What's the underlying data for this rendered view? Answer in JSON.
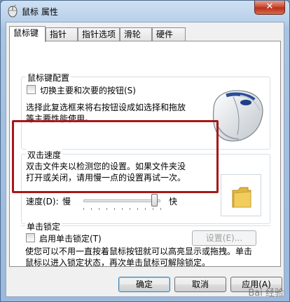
{
  "window": {
    "title": "鼠标 属性",
    "close_glyph": "✕"
  },
  "tabs": [
    {
      "label": "鼠标键",
      "active": true
    },
    {
      "label": "指针",
      "active": false
    },
    {
      "label": "指针选项",
      "active": false
    },
    {
      "label": "滑轮",
      "active": false
    },
    {
      "label": "硬件",
      "active": false
    }
  ],
  "button_config": {
    "group_label": "鼠标键配置",
    "switch_checkbox_label": "切换主要和次要的按钮(S)",
    "switch_checked": false,
    "description_line1": "选择此复选框来将右按钮设成如选择和拖放",
    "description_line2": "等主要性能使用。"
  },
  "double_click": {
    "group_label": "双击速度",
    "description_line1": "双击文件夹以检测您的设置。如果文件夹没",
    "description_line2": "打开或关闭，请用慢一点的设置再试一次。",
    "speed_label": "速度(D):",
    "slow_label": "慢",
    "fast_label": "快",
    "speed_value_fraction": 0.92
  },
  "click_lock": {
    "group_label": "单击锁定",
    "checkbox_label": "启用单击锁定(T)",
    "checked": false,
    "settings_button": "设置(E)...",
    "description_line1": "使您可以不用一直按着鼠标按钮就可以高亮显示或拖拽。单击",
    "description_line2": "鼠标以进入锁定状态，再次单击鼠标可解除锁定。"
  },
  "footer": {
    "ok": "确定",
    "cancel": "取消",
    "apply": "应用(A)"
  },
  "watermark": "Bai 经验",
  "colors": {
    "annotation": "#a71818",
    "folder": "#f0cd5c"
  },
  "icons": {
    "title": "mouse-icon",
    "mouse_image": "mouse-illustration",
    "folder": "folder-icon"
  }
}
